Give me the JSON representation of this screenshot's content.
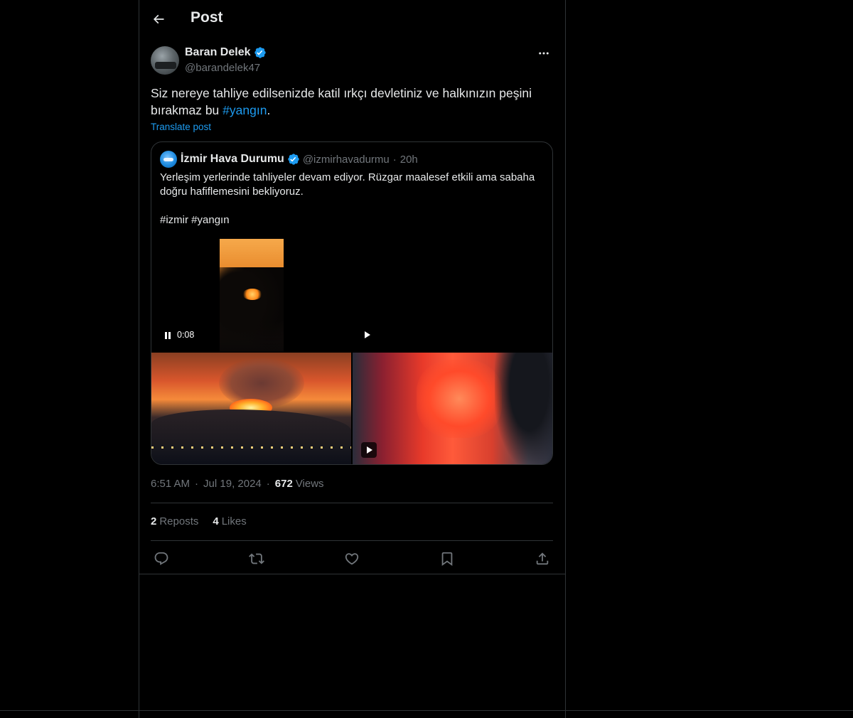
{
  "header": {
    "title": "Post"
  },
  "post": {
    "author_name": "Baran Delek",
    "author_handle": "@barandelek47",
    "text_before": "Siz nereye tahliye edilsenizde katil ırkçı devletiniz ve halkınızın peşini bırakmaz bu ",
    "hashtag": "#yangın",
    "text_after": ".",
    "translate_label": "Translate post",
    "time": "6:51 AM",
    "date": "Jul 19, 2024",
    "views_count": "672",
    "views_label": "Views",
    "reposts_count": "2",
    "reposts_label": "Reposts",
    "likes_count": "4",
    "likes_label": "Likes"
  },
  "quote": {
    "author_name": "İzmir Hava Durumu",
    "author_handle": "@izmirhavadurmu",
    "time": "20h",
    "text": "Yerleşim yerlerinde tahliyeler devam ediyor. Rüzgar maalesef etkili ama sabaha doğru hafiflemesini bekliyoruz.\n\n#izmir #yangın",
    "video_time": "0:08"
  },
  "colors": {
    "accent": "#1d9bf0",
    "secondary_text": "#71767b",
    "border": "#2f3336"
  },
  "icons": {
    "back": "arrow-left-icon",
    "verified": "verified-badge-icon",
    "more": "more-icon",
    "reply": "reply-icon",
    "repost": "repost-icon",
    "like": "heart-icon",
    "bookmark": "bookmark-icon",
    "share": "share-icon"
  }
}
